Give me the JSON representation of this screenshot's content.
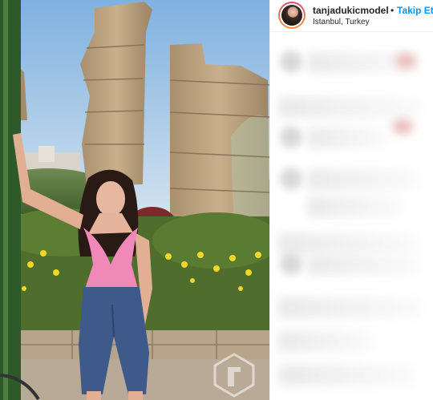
{
  "post": {
    "username": "tanjadukicmodel",
    "separator": "•",
    "follow_label": "Takip Et",
    "location": "Istanbul, Turkey"
  },
  "icons": {
    "avatar": "profile-avatar",
    "watermark": "logo-watermark"
  }
}
